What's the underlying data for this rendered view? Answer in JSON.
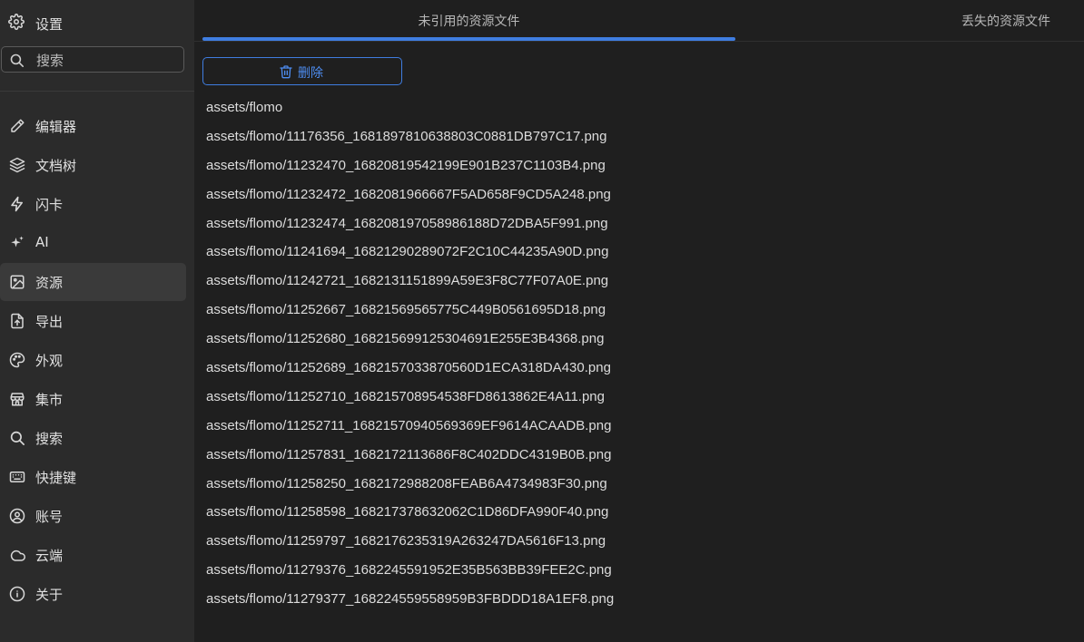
{
  "sidebar": {
    "header_title": "设置",
    "search_placeholder": "搜索",
    "items": [
      {
        "label": "编辑器"
      },
      {
        "label": "文档树"
      },
      {
        "label": "闪卡"
      },
      {
        "label": "AI"
      },
      {
        "label": "资源"
      },
      {
        "label": "导出"
      },
      {
        "label": "外观"
      },
      {
        "label": "集市"
      },
      {
        "label": "搜索"
      },
      {
        "label": "快捷键"
      },
      {
        "label": "账号"
      },
      {
        "label": "云端"
      },
      {
        "label": "关于"
      }
    ],
    "active_item": "资源"
  },
  "tabs": [
    {
      "label": "未引用的资源文件"
    },
    {
      "label": "丢失的资源文件"
    }
  ],
  "toolbar": {
    "delete_label": "删除"
  },
  "files": [
    "assets/flomo",
    "assets/flomo/11176356_1681897810638803C0881DB797C17.png",
    "assets/flomo/11232470_16820819542199E901B237C1103B4.png",
    "assets/flomo/11232472_1682081966667F5AD658F9CD5A248.png",
    "assets/flomo/11232474_168208197058986188D72DBA5F991.png",
    "assets/flomo/11241694_16821290289072F2C10C44235A90D.png",
    "assets/flomo/11242721_1682131151899A59E3F8C77F07A0E.png",
    "assets/flomo/11252667_16821569565775C449B0561695D18.png",
    "assets/flomo/11252680_168215699125304691E255E3B4368.png",
    "assets/flomo/11252689_1682157033870560D1ECA318DA430.png",
    "assets/flomo/11252710_168215708954538FD8613862E4A11.png",
    "assets/flomo/11252711_16821570940569369EF9614ACAADB.png",
    "assets/flomo/11257831_1682172113686F8C402DDC4319B0B.png",
    "assets/flomo/11258250_1682172988208FEAB6A4734983F30.png",
    "assets/flomo/11258598_168217378632062C1D86DFA990F40.png",
    "assets/flomo/11259797_1682176235319A263247DA5616F13.png",
    "assets/flomo/11279376_1682245591952E35B563BB39FEE2C.png",
    "assets/flomo/11279377_168224559558959B3FBDDD18A1EF8.png"
  ],
  "colors": {
    "accent": "#3f7de0",
    "sidebar_bg": "#2b2b2b",
    "main_bg": "#1f1f1f",
    "active_item_bg": "#3a3a3a"
  }
}
